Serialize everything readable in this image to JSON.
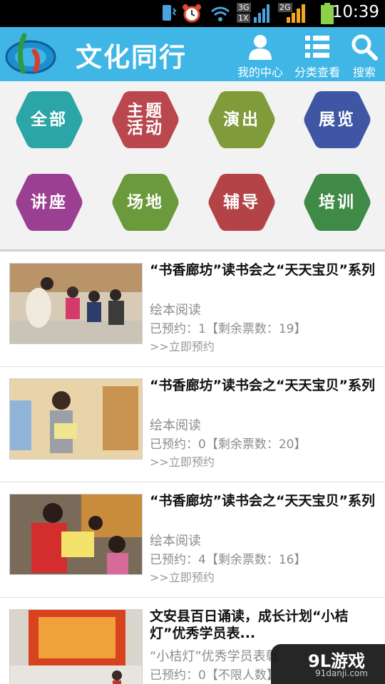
{
  "status": {
    "time": "10:39",
    "net1": "3G",
    "net2": "1X",
    "net3": "2G"
  },
  "header": {
    "title": "文化同行",
    "profile_label": "我的中心",
    "category_label": "分类查看",
    "search_label": "搜索"
  },
  "categories": [
    {
      "label": "全部",
      "color": "#2ba5a5"
    },
    {
      "label": "主题\n活动",
      "color": "#b9474d"
    },
    {
      "label": "演出",
      "color": "#7f9b3a"
    },
    {
      "label": "展览",
      "color": "#3e56a3"
    },
    {
      "label": "讲座",
      "color": "#9a3f91"
    },
    {
      "label": "场地",
      "color": "#6a9a3b"
    },
    {
      "label": "辅导",
      "color": "#b34347"
    },
    {
      "label": "培训",
      "color": "#3f8a47"
    }
  ],
  "items": [
    {
      "title": "“书香廊坊”读书会之“天天宝贝”系列",
      "category": "绘本阅读",
      "count": "已预约：1【剩余票数：19】",
      "link": ">>立即预约"
    },
    {
      "title": "“书香廊坊”读书会之“天天宝贝”系列",
      "category": "绘本阅读",
      "count": "已预约：0【剩余票数：20】",
      "link": ">>立即预约"
    },
    {
      "title": "“书香廊坊”读书会之“天天宝贝”系列",
      "category": "绘本阅读",
      "count": "已预约：4【剩余票数：16】",
      "link": ">>立即预约"
    },
    {
      "title": "文安县百日诵读，成长计划“小桔灯”优秀学员表...",
      "category": "“小桔灯”优秀学员表彰",
      "count": "已预约：0【不限人数】",
      "link": ""
    }
  ],
  "watermark": {
    "brand": "9L游戏",
    "site": "91danji.com"
  }
}
